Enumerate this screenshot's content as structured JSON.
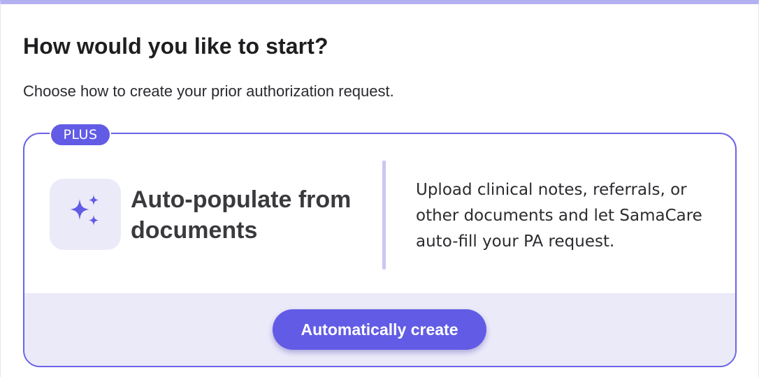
{
  "page": {
    "title": "How would you like to start?",
    "subtitle": "Choose how to create your prior authorization request."
  },
  "option_card": {
    "badge": "PLUS",
    "icon": "sparkles-icon",
    "title": "Auto-populate from documents",
    "description": "Upload clinical notes, referrals, or other documents and let SamaCare auto-fill your PA request.",
    "button_label": "Automatically create"
  },
  "colors": {
    "accent": "#625be6",
    "accent_light": "#ebeaf9",
    "card_border": "#6a63e8",
    "top_bar": "#b3b0f2"
  }
}
